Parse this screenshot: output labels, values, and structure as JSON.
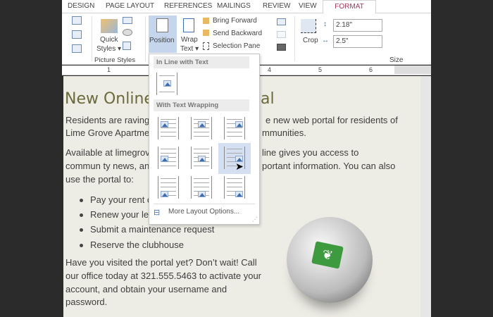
{
  "tabs": [
    "DESIGN",
    "PAGE LAYOUT",
    "REFERENCES",
    "MAILINGS",
    "REVIEW",
    "VIEW",
    "FORMAT"
  ],
  "ribbon": {
    "quick_styles": "Quick\nStyles",
    "quick_label_1": "Quick",
    "quick_label_2": "Styles ▾",
    "group_picture_styles": "Picture Styles",
    "position_label": "Position",
    "wrap_label_1": "Wrap",
    "wrap_label_2": "Text ▾",
    "bring_forward": "Bring Forward",
    "send_backward": "Send Backward",
    "selection_pane": "Selection Pane",
    "crop_label": "Crop",
    "height_value": "2.18\"",
    "width_value": "2.5\"",
    "group_size": "Size"
  },
  "ruler": [
    "1",
    "4",
    "5",
    "6"
  ],
  "dropdown": {
    "section1": "In Line with Text",
    "section2": "With Text Wrapping",
    "more": "More Layout Options..."
  },
  "doc": {
    "title_left": "New Online",
    "title_right": "al",
    "p1_l1_left": "Residents are raving a",
    "p1_l1_right": "e new web portal for residents of",
    "p1_l2_left": "Lime Grove Apartme",
    "p1_l2_right": "mmunities.",
    "p2_l1_left": "Available at limegrov",
    "p2_l1_right": "line gives you access to",
    "p2_l2_left": "commun ty news, an",
    "p2_l2_right": "portant information. You can also",
    "p2_l3": "use the portal to:",
    "bullets": [
      "Pay your rent o",
      "Renew your le",
      "Submit a maintenance request",
      "Reserve the clubhouse"
    ],
    "p3": [
      "Have you visited the portal yet? Don’t wait! Call",
      "our office today at 321.555.5463 to activate your",
      "account, and obtain your username and",
      "password."
    ]
  },
  "colors": {
    "accent": "#a4375d",
    "title": "#6b6a3c",
    "page": "#eeede5",
    "selected": "#c5d5ec"
  }
}
